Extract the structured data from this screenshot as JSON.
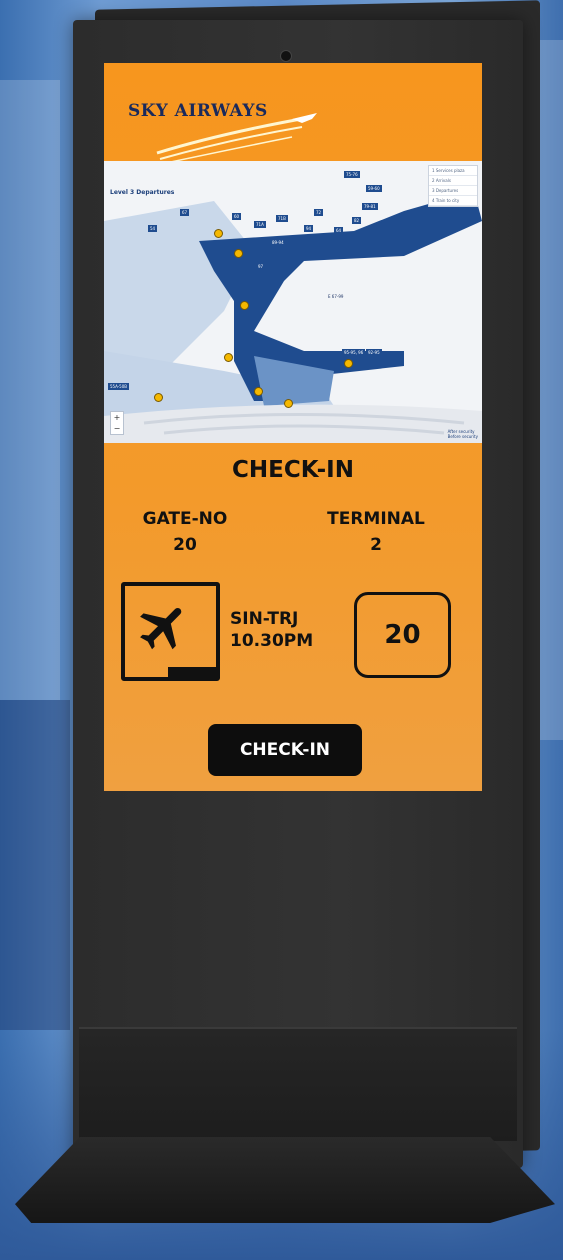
{
  "brand": {
    "logo_text": "SKY AIRWAYS"
  },
  "map": {
    "level_label": "Level 3  Departures",
    "legend": [
      "1  Services plaza",
      "2  Arrivals",
      "3  Departures",
      "4  Train to city"
    ],
    "legend_bottom": [
      "After security",
      "Before security"
    ],
    "zoom_in": "+",
    "zoom_out": "−",
    "gate_labels": [
      "75-76",
      "59-60",
      "79-81",
      "60",
      "72",
      "82",
      "71A",
      "71B",
      "94",
      "64",
      "89-94",
      "E 67-99",
      "95-95, 96",
      "92-95",
      "55A-50B",
      "54",
      "67",
      "97"
    ]
  },
  "checkin": {
    "title": "CHECK-IN",
    "gate_label": "GATE-NO",
    "gate_value": "20",
    "terminal_label": "TERMINAL",
    "terminal_value": "2",
    "route": "SIN-TRJ",
    "time": "10.30PM",
    "gate_box_value": "20",
    "button_label": "CHECK-IN"
  },
  "colors": {
    "screen_orange": "#f7961e",
    "logo_navy": "#1a2a5c",
    "map_blue": "#1f4c8f"
  }
}
